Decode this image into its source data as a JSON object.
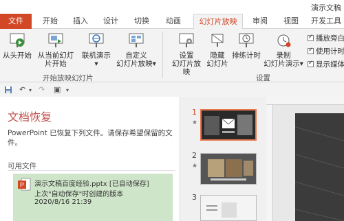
{
  "window": {
    "title": "演示文稿"
  },
  "tabs": {
    "file": "文件",
    "items": [
      "开始",
      "插入",
      "设计",
      "切换",
      "动画",
      "幻灯片放映",
      "审阅",
      "视图",
      "开发工具"
    ],
    "active_index": 5
  },
  "ribbon": {
    "start_group": {
      "from_beginning": "从头开始",
      "from_current_1": "从当前幻灯",
      "from_current_2": "片开始",
      "online_1": "联机演示",
      "custom_1": "自定义",
      "custom_2": "幻灯片放映",
      "label": "开始放映幻灯片"
    },
    "setup_group": {
      "setup_1": "设置",
      "setup_2": "幻灯片放映",
      "hide_1": "隐藏",
      "hide_2": "幻灯片",
      "rehearse": "排练计时",
      "record_1": "录制",
      "record_2": "幻灯片演示",
      "label": "设置"
    },
    "checkboxes": [
      "播放旁白",
      "使用计时",
      "显示媒体"
    ]
  },
  "qat": {
    "save": "save-icon",
    "undo": "undo-icon",
    "redo": "redo-icon"
  },
  "recovery": {
    "title": "文档恢复",
    "description": "PowerPoint 已恢复下列文件。请保存希望保留的文件。",
    "available_label": "可用文件",
    "file": {
      "name_line": "演示文稿百度经验.pptx  [已自动保存]",
      "status_line": "上次\"自动保存\"时创建的版本",
      "datetime": "2020/8/16 21:39"
    }
  },
  "slides": {
    "numbers": [
      "1",
      "2",
      "3"
    ],
    "active": "1"
  },
  "colors": {
    "accent": "#d24726",
    "file_card": "#cfe5c9",
    "heading": "#c0504d"
  }
}
